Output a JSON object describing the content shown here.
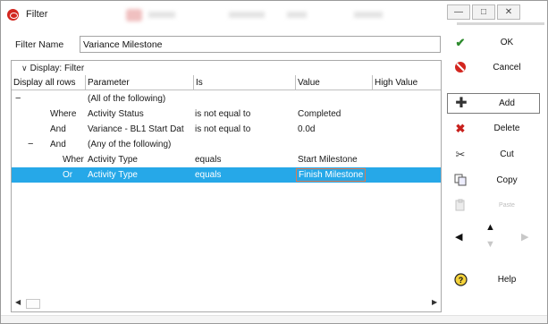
{
  "window": {
    "title": "Filter",
    "minimize": "—",
    "maximize": "□",
    "close": "✕"
  },
  "filter_name": {
    "label": "Filter Name",
    "value": "Variance Milestone"
  },
  "display": {
    "label": "Display: Filter"
  },
  "columns": [
    "Display all rows",
    "Parameter",
    "Is",
    "Value",
    "High Value"
  ],
  "rows": [
    {
      "toggle": "−",
      "connector": "",
      "parameter": "(All of the following)",
      "is": "",
      "value": ""
    },
    {
      "toggle": "",
      "connector": "Where",
      "parameter": "Activity Status",
      "is": "is not equal to",
      "value": "Completed"
    },
    {
      "toggle": "",
      "connector": "And",
      "parameter": "Variance - BL1 Start Dat",
      "is": "is not equal to",
      "value": "0.0d"
    },
    {
      "toggle": "−",
      "connector": "And",
      "parameter": "(Any of the following)",
      "is": "",
      "value": ""
    },
    {
      "toggle": "",
      "connector": "Wher",
      "parameter": "Activity Type",
      "is": "equals",
      "value": "Start Milestone"
    },
    {
      "toggle": "",
      "connector": "Or",
      "parameter": "Activity Type",
      "is": "equals",
      "value": "Finish Milestone"
    }
  ],
  "buttons": {
    "ok": "OK",
    "cancel": "Cancel",
    "add": "Add",
    "delete": "Delete",
    "cut": "Cut",
    "copy": "Copy",
    "paste": "Paste",
    "help": "Help"
  },
  "icons": {
    "ok": "check-icon",
    "cancel": "no-entry-icon",
    "add": "plus-icon",
    "delete": "x-delete-icon",
    "cut": "scissors-icon",
    "copy": "copy-icon",
    "paste": "paste-icon",
    "help": "help-icon"
  },
  "colors": {
    "selection": "#26a8e8",
    "ok_green": "#2e8b2e",
    "cancel_red": "#d3261f",
    "delete_red": "#c8201c"
  }
}
